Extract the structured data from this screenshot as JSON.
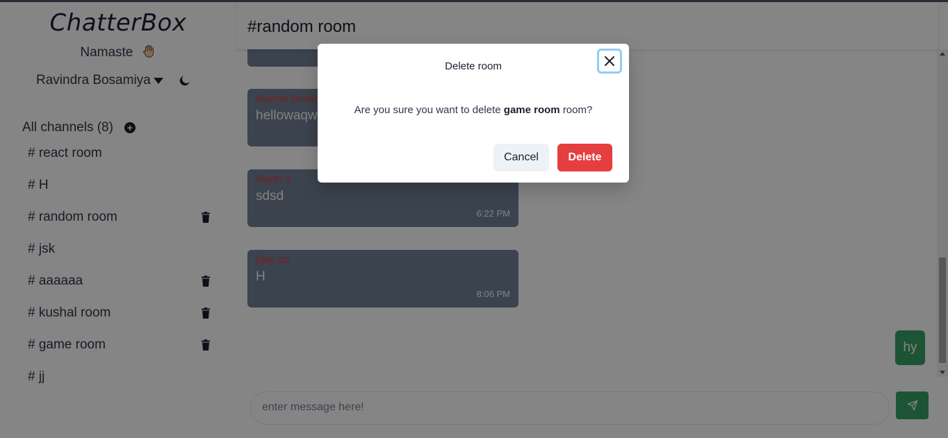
{
  "app": {
    "name": "ChatterBox",
    "greeting": "Namaste",
    "user_name": "Ravindra Bosamiya"
  },
  "sidebar": {
    "channels_label": "All channels (8)",
    "add_icon": "plus-circle-icon",
    "channels": [
      {
        "label": "# react room",
        "deletable": false
      },
      {
        "label": "# H",
        "deletable": false
      },
      {
        "label": "# random room",
        "deletable": true
      },
      {
        "label": "# jsk",
        "deletable": false
      },
      {
        "label": "# aaaaaa",
        "deletable": true
      },
      {
        "label": "# kushal room",
        "deletable": true
      },
      {
        "label": "# game room",
        "deletable": true
      },
      {
        "label": "# jj",
        "deletable": false
      }
    ]
  },
  "chat": {
    "title": "#random room",
    "messages": [
      {
        "author": "Kushal Bosamiya",
        "text": "hellowaqwq",
        "time": ""
      },
      {
        "author": "Vijeth X",
        "text": "sdsd",
        "time": "6:22 PM"
      },
      {
        "author": "play up",
        "text": "H",
        "time": "8:06 PM"
      }
    ],
    "own_message": "hy",
    "input_placeholder": "enter message here!"
  },
  "modal": {
    "title": "Delete room",
    "body_prefix": "Are you sure you want to delete",
    "room_name": "game room",
    "body_suffix": "room?",
    "cancel_label": "Cancel",
    "delete_label": "Delete"
  },
  "colors": {
    "accent_green": "#38a169",
    "danger_red": "#e53e3e",
    "message_bg": "#718096",
    "author_red": "#e53e3e"
  }
}
